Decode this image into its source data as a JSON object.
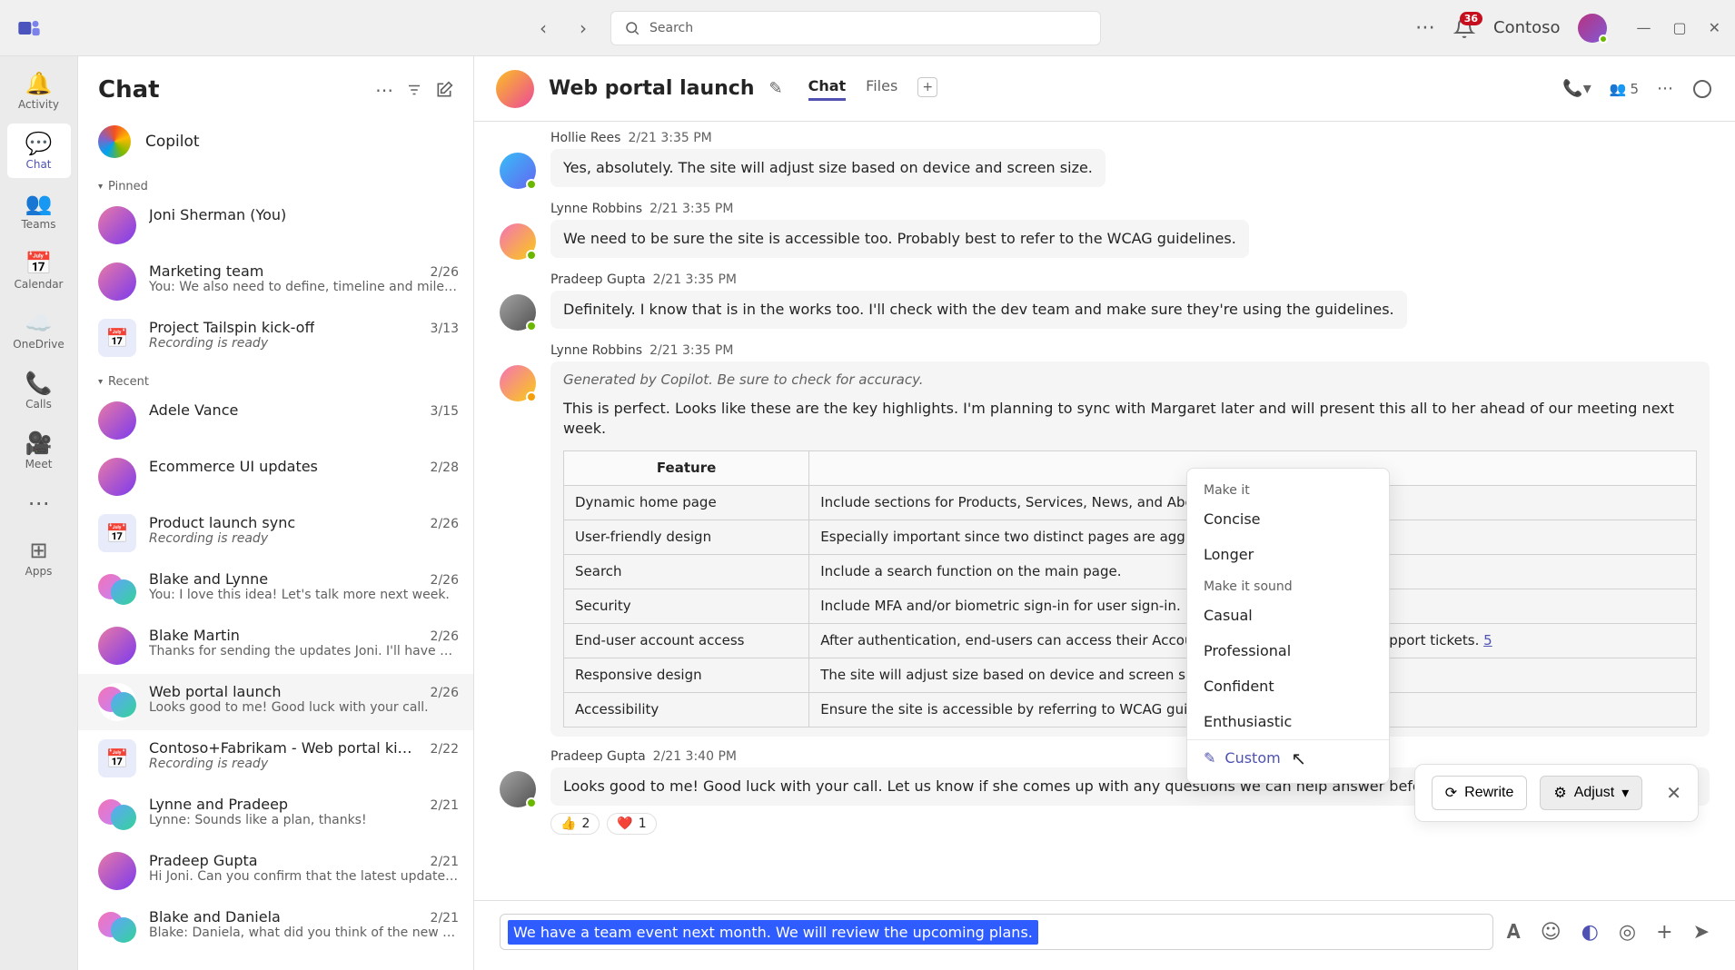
{
  "titlebar": {
    "search_placeholder": "Search",
    "badge_count": "36",
    "org_name": "Contoso"
  },
  "rail": {
    "activity": "Activity",
    "chat": "Chat",
    "teams": "Teams",
    "calendar": "Calendar",
    "onedrive": "OneDrive",
    "calls": "Calls",
    "meet": "Meet",
    "apps": "Apps"
  },
  "chat_panel": {
    "title": "Chat",
    "copilot": "Copilot",
    "pinned_label": "Pinned",
    "recent_label": "Recent",
    "pinned": [
      {
        "name": "Joni Sherman (You)",
        "preview": "",
        "date": ""
      },
      {
        "name": "Marketing team",
        "preview": "You: We also need to define, timeline and miles…",
        "date": "2/26"
      },
      {
        "name": "Project Tailspin kick-off",
        "preview": "Recording is ready",
        "date": "3/13",
        "italic": true,
        "cal": true
      }
    ],
    "recent": [
      {
        "name": "Adele Vance",
        "preview": "",
        "date": "3/15"
      },
      {
        "name": "Ecommerce UI updates",
        "preview": "",
        "date": "2/28"
      },
      {
        "name": "Product launch sync",
        "preview": "Recording is ready",
        "date": "2/26",
        "italic": true,
        "cal": true
      },
      {
        "name": "Blake and Lynne",
        "preview": "You: I love this idea! Let's talk more next week.",
        "date": "2/26",
        "duo": true
      },
      {
        "name": "Blake Martin",
        "preview": "Thanks for sending the updates Joni. I'll have s…",
        "date": "2/26"
      },
      {
        "name": "Web portal launch",
        "preview": "Looks good to me! Good luck with your call.",
        "date": "2/26",
        "selected": true,
        "duo": true
      },
      {
        "name": "Contoso+Fabrikam - Web portal ki…",
        "preview": "Recording is ready",
        "date": "2/22",
        "italic": true,
        "cal": true
      },
      {
        "name": "Lynne and Pradeep",
        "preview": "Lynne: Sounds like a plan, thanks!",
        "date": "2/21",
        "duo": true
      },
      {
        "name": "Pradeep Gupta",
        "preview": "Hi Joni. Can you confirm that the latest updates…",
        "date": "2/21"
      },
      {
        "name": "Blake and Daniela",
        "preview": "Blake: Daniela, what did you think of the new d…",
        "date": "2/21",
        "duo": true
      }
    ]
  },
  "conversation": {
    "title": "Web portal launch",
    "tab_chat": "Chat",
    "tab_files": "Files",
    "participant_count": "5",
    "messages": [
      {
        "author": "Hollie Rees",
        "time": "2/21 3:35 PM",
        "text": "Yes, absolutely. The site will adjust size based on device and screen size.",
        "av": "a1"
      },
      {
        "author": "Lynne Robbins",
        "time": "2/21 3:35 PM",
        "text": "We need to be sure the site is accessible too. Probably best to refer to the WCAG guidelines.",
        "av": "a2"
      },
      {
        "author": "Pradeep Gupta",
        "time": "2/21 3:35 PM",
        "text": "Definitely. I know that is in the works too. I'll check with the dev team and make sure they're using the guidelines.",
        "av": "a3"
      }
    ],
    "copilot_msg": {
      "author": "Lynne Robbins",
      "time": "2/21 3:35 PM",
      "note": "Generated by Copilot. Be sure to check for accuracy.",
      "text": "This is perfect. Looks like these are the key highlights. I'm planning to sync with Margaret later and will present this all to her ahead of our meeting next week.",
      "table_header_feature": "Feature",
      "rows": [
        {
          "f": "Dynamic home page",
          "d": "Include sections for Products, Services, News, and About Us."
        },
        {
          "f": "User-friendly design",
          "d": "Especially important since two distinct pages are aggregated."
        },
        {
          "f": "Search",
          "d": "Include a search function on the main page."
        },
        {
          "f": "Security",
          "d": "Include MFA and/or biometric sign-in for user sign-in."
        },
        {
          "f": "End-user account access",
          "d": "After authentication, end-users can access their Accounts, Orders, Invoices, and Support tickets. ",
          "link": "5"
        },
        {
          "f": "Responsive design",
          "d": "The site will adjust size based on device and screen size."
        },
        {
          "f": "Accessibility",
          "d": "Ensure the site is accessible by referring to WCAG guidelines."
        }
      ]
    },
    "final_msg": {
      "author": "Pradeep Gupta",
      "time": "2/21 3:40 PM",
      "text": "Looks good to me! Good luck with your call. Let us know if she comes up with any questions we can help answer before the on-site meeting.",
      "reactions": [
        {
          "emoji": "👍",
          "count": "2"
        },
        {
          "emoji": "❤️",
          "count": "1"
        }
      ]
    }
  },
  "rewrite": {
    "rewrite_label": "Rewrite",
    "adjust_label": "Adjust"
  },
  "adjust_popup": {
    "make_it": "Make it",
    "concise": "Concise",
    "longer": "Longer",
    "make_it_sound": "Make it sound",
    "casual": "Casual",
    "professional": "Professional",
    "confident": "Confident",
    "enthusiastic": "Enthusiastic",
    "custom": "Custom"
  },
  "compose": {
    "draft_text": "We have a team event next month. We will review the upcoming plans."
  }
}
